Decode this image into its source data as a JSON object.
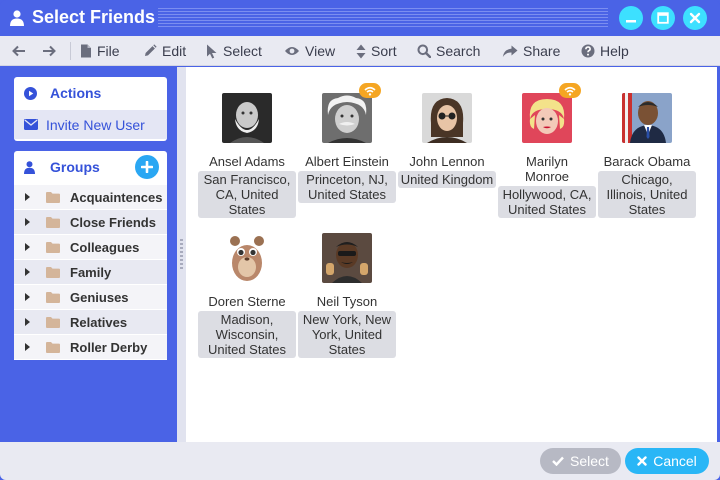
{
  "window": {
    "title": "Select Friends"
  },
  "toolbar": {
    "file": "File",
    "edit": "Edit",
    "select": "Select",
    "view": "View",
    "sort": "Sort",
    "search": "Search",
    "share": "Share",
    "help": "Help"
  },
  "sidebar": {
    "actions": {
      "heading": "Actions",
      "invite": "Invite New User"
    },
    "groups": {
      "heading": "Groups",
      "items": [
        {
          "label": "Acquaintences"
        },
        {
          "label": "Close Friends"
        },
        {
          "label": "Colleagues"
        },
        {
          "label": "Family"
        },
        {
          "label": "Geniuses"
        },
        {
          "label": "Relatives"
        },
        {
          "label": "Roller Derby"
        }
      ]
    }
  },
  "friends": [
    {
      "name": "Ansel Adams",
      "location": "San Francisco, CA, United States",
      "online": false
    },
    {
      "name": "Albert Einstein",
      "location": "Princeton, NJ, United States",
      "online": true
    },
    {
      "name": "John Lennon",
      "location": "United Kingdom",
      "online": false
    },
    {
      "name": "Marilyn Monroe",
      "location": "Hollywood, CA, United States",
      "online": true
    },
    {
      "name": "Barack Obama",
      "location": "Chicago, Illinois, United States",
      "online": false
    },
    {
      "name": "Doren Sterne",
      "location": "Madison, Wisconsin, United States",
      "online": false
    },
    {
      "name": "Neil Tyson",
      "location": "New York, New York, United States",
      "online": false
    }
  ],
  "footer": {
    "select": "Select",
    "cancel": "Cancel"
  },
  "colors": {
    "accent": "#4a63e6",
    "link": "#3552d9",
    "cancel": "#29b6f6",
    "select_disabled": "#b7b9c4",
    "online_badge": "#f5a623"
  }
}
